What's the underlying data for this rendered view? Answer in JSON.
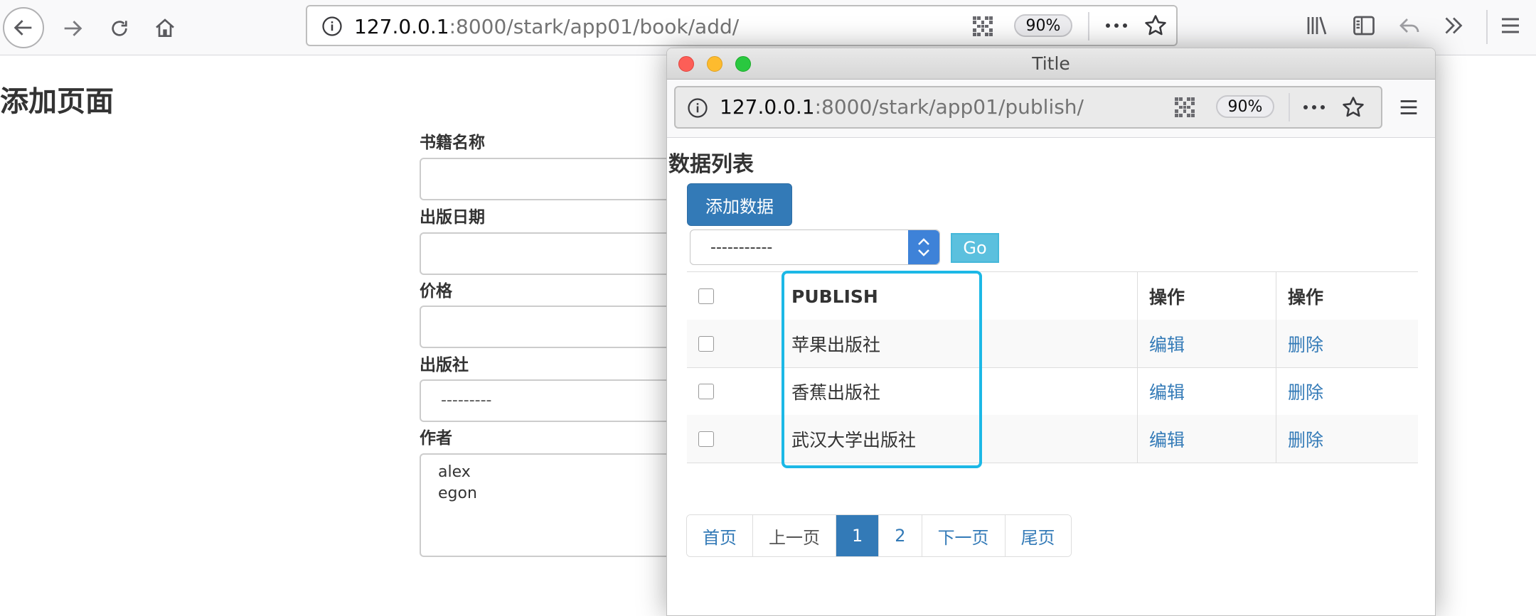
{
  "browser": {
    "url_host": "127.0.0.1",
    "url_rest": ":8000/stark/app01/book/add/",
    "zoom": "90%"
  },
  "page": {
    "title": "添加页面",
    "fields": [
      {
        "label": "书籍名称"
      },
      {
        "label": "出版日期"
      },
      {
        "label": "价格"
      },
      {
        "label": "出版社",
        "selected": "---------"
      },
      {
        "label": "作者",
        "options": [
          "alex",
          "egon"
        ]
      }
    ]
  },
  "popup": {
    "window_title": "Title",
    "url_host": "127.0.0.1",
    "url_rest": ":8000/stark/app01/publish/",
    "zoom": "90%",
    "heading": "数据列表",
    "add_button": "添加数据",
    "action_select": "-----------",
    "go_button": "Go",
    "table": {
      "headers": [
        "PUBLISH",
        "操作",
        "操作"
      ],
      "rows": [
        {
          "name": "苹果出版社",
          "edit": "编辑",
          "delete": "删除"
        },
        {
          "name": "香蕉出版社",
          "edit": "编辑",
          "delete": "删除"
        },
        {
          "name": "武汉大学出版社",
          "edit": "编辑",
          "delete": "删除"
        }
      ]
    },
    "pagination": [
      "首页",
      "上一页",
      "1",
      "2",
      "下一页",
      "尾页"
    ],
    "highlight_color": "#1cb8e6"
  },
  "colors": {
    "primary": "#337ab7",
    "info": "#5bc0de",
    "traffic_close": "#fd5e57",
    "traffic_min": "#fdbb2e",
    "traffic_max": "#2ac840"
  }
}
